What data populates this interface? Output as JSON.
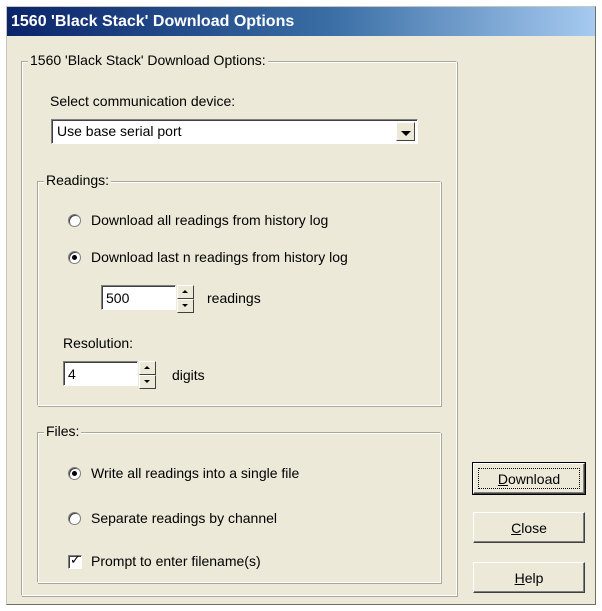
{
  "window": {
    "title": "1560 'Black Stack' Download Options"
  },
  "options_group": {
    "legend": "1560 'Black Stack' Download Options:"
  },
  "device": {
    "label": "Select communication device:",
    "selected": "Use base serial port"
  },
  "readings": {
    "legend": "Readings:",
    "option_all": "Download all readings from history log",
    "option_last_n": "Download last n readings from history log",
    "selected_option": "last_n",
    "count_value": "500",
    "count_unit": "readings",
    "resolution_label": "Resolution:",
    "resolution_value": "4",
    "resolution_unit": "digits"
  },
  "files": {
    "legend": "Files:",
    "option_single": "Write all readings into a single file",
    "option_separate": "Separate readings by channel",
    "selected_option": "single",
    "prompt_label": "Prompt to enter filename(s)",
    "prompt_checked": true
  },
  "buttons": {
    "download": {
      "accel": "D",
      "rest": "ownload"
    },
    "close": {
      "accel": "C",
      "rest": "lose"
    },
    "help": {
      "accel": "H",
      "rest": "elp"
    }
  }
}
